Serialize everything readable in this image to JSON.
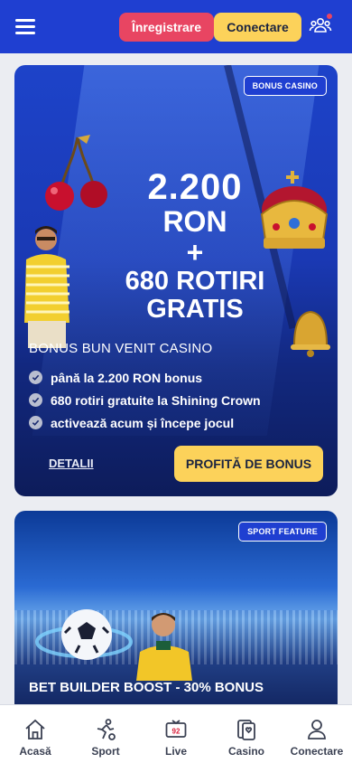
{
  "header": {
    "register_label": "Înregistrare",
    "login_label": "Conectare"
  },
  "casino_card": {
    "badge": "BONUS CASINO",
    "promo_amount": "2.200",
    "promo_currency": "RON",
    "promo_plus": "+",
    "promo_spins": "680 ROTIRI",
    "promo_free": "GRATIS",
    "title": "BONUS BUN VENIT CASINO",
    "bullets": [
      "până la 2.200 RON bonus",
      "680 rotiri gratuite la Shining Crown",
      "activează acum și începe jocul"
    ],
    "details_link": "DETALII",
    "cta_label": "PROFITĂ DE BONUS"
  },
  "sport_card": {
    "badge": "SPORT FEATURE",
    "title": "BET BUILDER BOOST - 30% BONUS"
  },
  "bottom_nav": [
    {
      "label": "Acasă",
      "icon": "home-icon"
    },
    {
      "label": "Sport",
      "icon": "sport-icon"
    },
    {
      "label": "Live",
      "icon": "live-tv-icon",
      "counter": "92"
    },
    {
      "label": "Casino",
      "icon": "casino-cards-icon"
    },
    {
      "label": "Conectare",
      "icon": "user-icon"
    }
  ],
  "colors": {
    "brand_blue": "#1f3fd1",
    "register_red": "#e84562",
    "login_yellow": "#fcd25a"
  }
}
